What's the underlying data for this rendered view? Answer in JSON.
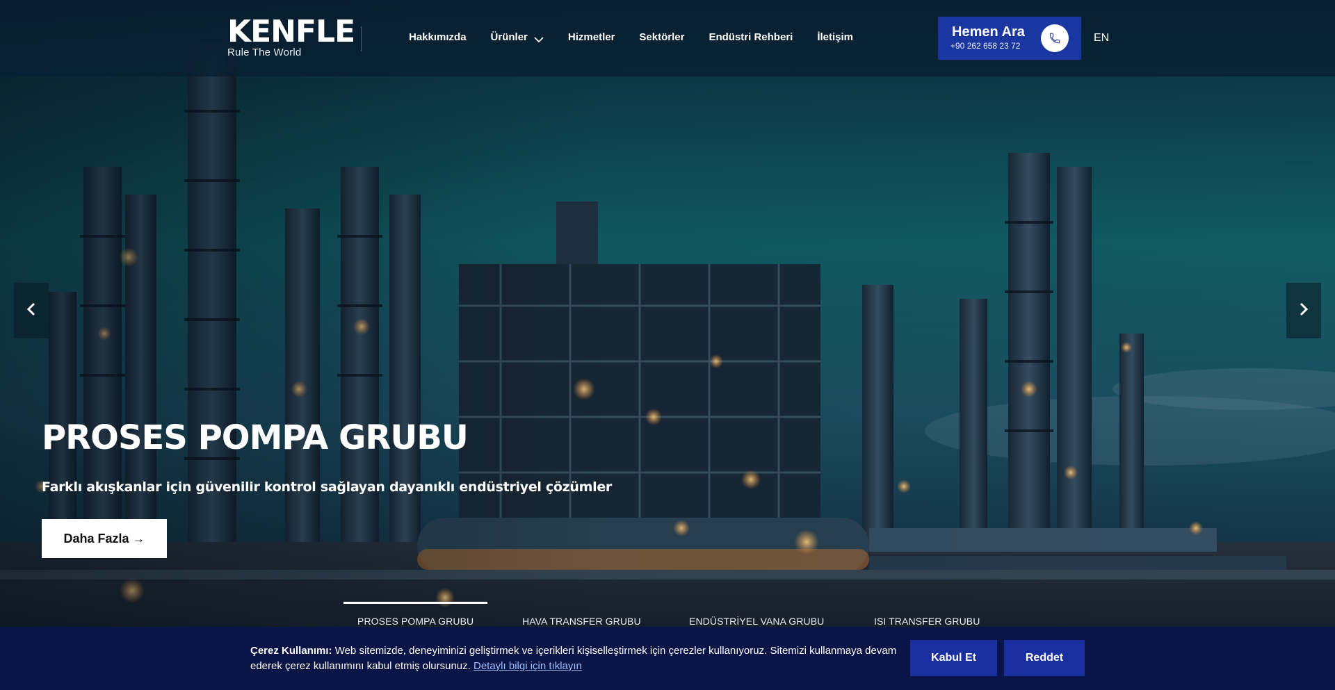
{
  "header": {
    "brand": "KENFLE",
    "tagline": "Rule The World",
    "nav": [
      {
        "label": "Hakkımızda"
      },
      {
        "label": "Ürünler"
      },
      {
        "label": "Hizmetler"
      },
      {
        "label": "Sektörler"
      },
      {
        "label": "Endüstri Rehberi"
      },
      {
        "label": "İletişim"
      }
    ],
    "call_title": "Hemen Ara",
    "call_number": "+90 262 658 23 72",
    "language": "EN"
  },
  "hero": {
    "title": "PROSES POMPA GRUBU",
    "subtitle": "Farklı akışkanlar için güvenilir kontrol sağlayan dayanıklı endüstriyel çözümler",
    "cta_label": "Daha Fazla  →"
  },
  "slider_tabs": [
    {
      "label": "PROSES POMPA GRUBU",
      "active": true
    },
    {
      "label": "HAVA TRANSFER GRUBU",
      "active": false
    },
    {
      "label": "ENDÜSTRİYEL VANA GRUBU",
      "active": false
    },
    {
      "label": "ISI TRANSFER GRUBU",
      "active": false
    }
  ],
  "cookie": {
    "title": "Çerez Kullanımı:",
    "message": "Web sitemizde, deneyiminizi geliştirmek ve içerikleri kişiselleştirmek için çerezler kullanıyoruz. Sitemizi kullanmaya devam ederek çerez kullanımını kabul etmiş olursunuz.",
    "link_label": "Detaylı bilgi için tıklayın",
    "accept_label": "Kabul Et",
    "reject_label": "Reddet"
  },
  "colors": {
    "primary": "#1a2fa0",
    "cookie_bg": "#0a1447",
    "header_bg": "#082032"
  }
}
